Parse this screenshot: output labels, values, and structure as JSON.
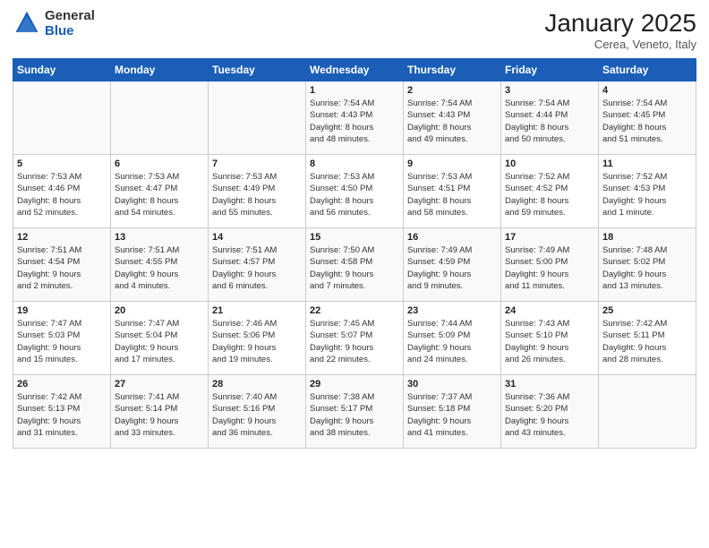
{
  "logo": {
    "general": "General",
    "blue": "Blue"
  },
  "header": {
    "month": "January 2025",
    "location": "Cerea, Veneto, Italy"
  },
  "weekdays": [
    "Sunday",
    "Monday",
    "Tuesday",
    "Wednesday",
    "Thursday",
    "Friday",
    "Saturday"
  ],
  "weeks": [
    [
      {
        "day": "",
        "info": ""
      },
      {
        "day": "",
        "info": ""
      },
      {
        "day": "",
        "info": ""
      },
      {
        "day": "1",
        "info": "Sunrise: 7:54 AM\nSunset: 4:43 PM\nDaylight: 8 hours\nand 48 minutes."
      },
      {
        "day": "2",
        "info": "Sunrise: 7:54 AM\nSunset: 4:43 PM\nDaylight: 8 hours\nand 49 minutes."
      },
      {
        "day": "3",
        "info": "Sunrise: 7:54 AM\nSunset: 4:44 PM\nDaylight: 8 hours\nand 50 minutes."
      },
      {
        "day": "4",
        "info": "Sunrise: 7:54 AM\nSunset: 4:45 PM\nDaylight: 8 hours\nand 51 minutes."
      }
    ],
    [
      {
        "day": "5",
        "info": "Sunrise: 7:53 AM\nSunset: 4:46 PM\nDaylight: 8 hours\nand 52 minutes."
      },
      {
        "day": "6",
        "info": "Sunrise: 7:53 AM\nSunset: 4:47 PM\nDaylight: 8 hours\nand 54 minutes."
      },
      {
        "day": "7",
        "info": "Sunrise: 7:53 AM\nSunset: 4:49 PM\nDaylight: 8 hours\nand 55 minutes."
      },
      {
        "day": "8",
        "info": "Sunrise: 7:53 AM\nSunset: 4:50 PM\nDaylight: 8 hours\nand 56 minutes."
      },
      {
        "day": "9",
        "info": "Sunrise: 7:53 AM\nSunset: 4:51 PM\nDaylight: 8 hours\nand 58 minutes."
      },
      {
        "day": "10",
        "info": "Sunrise: 7:52 AM\nSunset: 4:52 PM\nDaylight: 8 hours\nand 59 minutes."
      },
      {
        "day": "11",
        "info": "Sunrise: 7:52 AM\nSunset: 4:53 PM\nDaylight: 9 hours\nand 1 minute."
      }
    ],
    [
      {
        "day": "12",
        "info": "Sunrise: 7:51 AM\nSunset: 4:54 PM\nDaylight: 9 hours\nand 2 minutes."
      },
      {
        "day": "13",
        "info": "Sunrise: 7:51 AM\nSunset: 4:55 PM\nDaylight: 9 hours\nand 4 minutes."
      },
      {
        "day": "14",
        "info": "Sunrise: 7:51 AM\nSunset: 4:57 PM\nDaylight: 9 hours\nand 6 minutes."
      },
      {
        "day": "15",
        "info": "Sunrise: 7:50 AM\nSunset: 4:58 PM\nDaylight: 9 hours\nand 7 minutes."
      },
      {
        "day": "16",
        "info": "Sunrise: 7:49 AM\nSunset: 4:59 PM\nDaylight: 9 hours\nand 9 minutes."
      },
      {
        "day": "17",
        "info": "Sunrise: 7:49 AM\nSunset: 5:00 PM\nDaylight: 9 hours\nand 11 minutes."
      },
      {
        "day": "18",
        "info": "Sunrise: 7:48 AM\nSunset: 5:02 PM\nDaylight: 9 hours\nand 13 minutes."
      }
    ],
    [
      {
        "day": "19",
        "info": "Sunrise: 7:47 AM\nSunset: 5:03 PM\nDaylight: 9 hours\nand 15 minutes."
      },
      {
        "day": "20",
        "info": "Sunrise: 7:47 AM\nSunset: 5:04 PM\nDaylight: 9 hours\nand 17 minutes."
      },
      {
        "day": "21",
        "info": "Sunrise: 7:46 AM\nSunset: 5:06 PM\nDaylight: 9 hours\nand 19 minutes."
      },
      {
        "day": "22",
        "info": "Sunrise: 7:45 AM\nSunset: 5:07 PM\nDaylight: 9 hours\nand 22 minutes."
      },
      {
        "day": "23",
        "info": "Sunrise: 7:44 AM\nSunset: 5:09 PM\nDaylight: 9 hours\nand 24 minutes."
      },
      {
        "day": "24",
        "info": "Sunrise: 7:43 AM\nSunset: 5:10 PM\nDaylight: 9 hours\nand 26 minutes."
      },
      {
        "day": "25",
        "info": "Sunrise: 7:42 AM\nSunset: 5:11 PM\nDaylight: 9 hours\nand 28 minutes."
      }
    ],
    [
      {
        "day": "26",
        "info": "Sunrise: 7:42 AM\nSunset: 5:13 PM\nDaylight: 9 hours\nand 31 minutes."
      },
      {
        "day": "27",
        "info": "Sunrise: 7:41 AM\nSunset: 5:14 PM\nDaylight: 9 hours\nand 33 minutes."
      },
      {
        "day": "28",
        "info": "Sunrise: 7:40 AM\nSunset: 5:16 PM\nDaylight: 9 hours\nand 36 minutes."
      },
      {
        "day": "29",
        "info": "Sunrise: 7:38 AM\nSunset: 5:17 PM\nDaylight: 9 hours\nand 38 minutes."
      },
      {
        "day": "30",
        "info": "Sunrise: 7:37 AM\nSunset: 5:18 PM\nDaylight: 9 hours\nand 41 minutes."
      },
      {
        "day": "31",
        "info": "Sunrise: 7:36 AM\nSunset: 5:20 PM\nDaylight: 9 hours\nand 43 minutes."
      },
      {
        "day": "",
        "info": ""
      }
    ]
  ]
}
